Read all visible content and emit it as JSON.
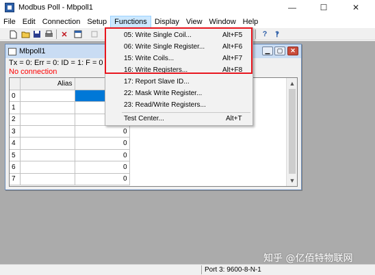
{
  "window": {
    "title": "Modbus Poll - Mbpoll1",
    "minimize": "—",
    "maximize": "☐",
    "close": "✕"
  },
  "menubar": [
    "File",
    "Edit",
    "Connection",
    "Setup",
    "Functions",
    "Display",
    "View",
    "Window",
    "Help"
  ],
  "functions_menu": {
    "items": [
      {
        "label": "05: Write Single Coil...",
        "shortcut": "Alt+F5"
      },
      {
        "label": "06: Write Single Register...",
        "shortcut": "Alt+F6"
      },
      {
        "label": "15: Write Coils...",
        "shortcut": "Alt+F7"
      },
      {
        "label": "16: Write Registers...",
        "shortcut": "Alt+F8"
      },
      {
        "label": "17: Report Slave ID...",
        "shortcut": ""
      },
      {
        "label": "22: Mask Write Register...",
        "shortcut": ""
      },
      {
        "label": "23: Read/Write Registers...",
        "shortcut": ""
      },
      {
        "label": "Test Center...",
        "shortcut": "Alt+T"
      }
    ]
  },
  "child": {
    "title": "Mbpoll1",
    "status": "Tx = 0: Err = 0: ID = 1: F = 0",
    "connection": "No connection",
    "grid": {
      "header_alias": "Alias",
      "rows": [
        {
          "index": "0",
          "value": ""
        },
        {
          "index": "1",
          "value": ""
        },
        {
          "index": "2",
          "value": ""
        },
        {
          "index": "3",
          "value": "0"
        },
        {
          "index": "4",
          "value": "0"
        },
        {
          "index": "5",
          "value": "0"
        },
        {
          "index": "6",
          "value": "0"
        },
        {
          "index": "7",
          "value": "0"
        }
      ]
    }
  },
  "statusbar": {
    "port": "Port 3: 9600-8-N-1"
  },
  "watermark": "知乎 @亿佰特物联网",
  "colors": {
    "highlight_box": "#e8141c",
    "no_connection": "#ff0000",
    "selected_cell": "#0078d7",
    "mdi_background": "#ababab"
  }
}
